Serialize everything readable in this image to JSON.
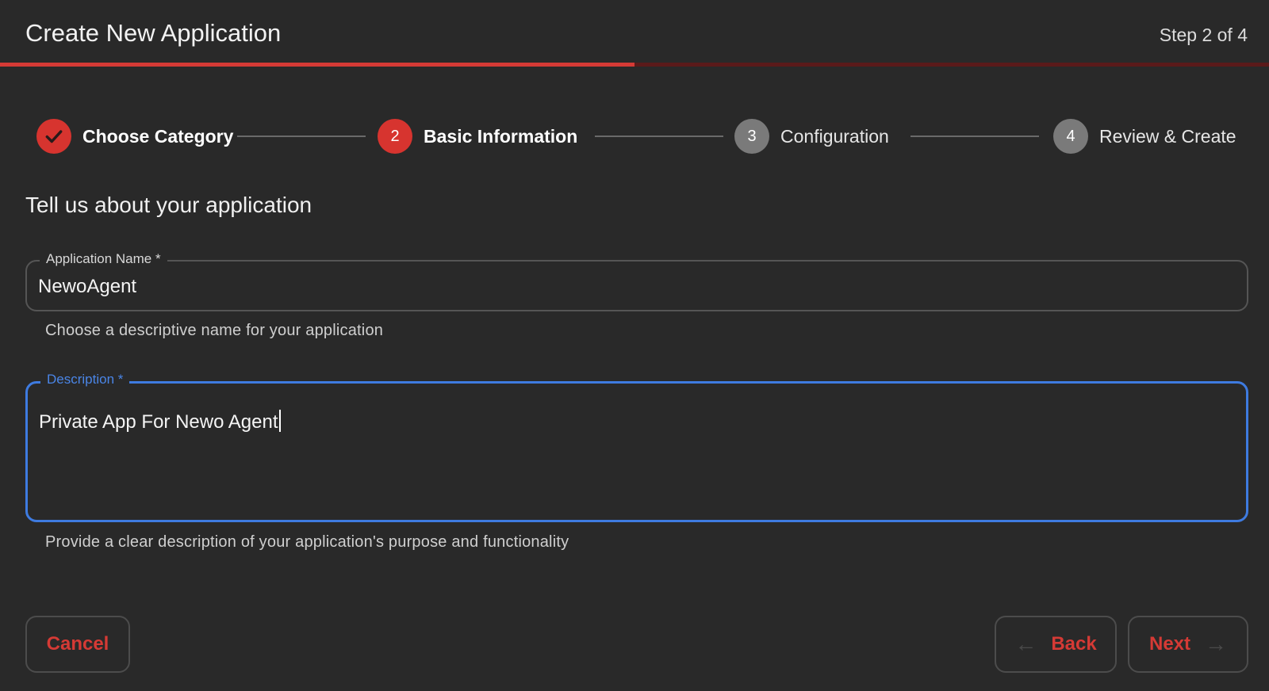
{
  "header": {
    "title": "Create New Application",
    "step_counter": "Step 2 of 4",
    "progress_fraction": 0.5
  },
  "stepper": {
    "steps": [
      {
        "label": "Choose Category",
        "number": "",
        "state": "completed",
        "icon": "check-icon"
      },
      {
        "label": "Basic Information",
        "number": "2",
        "state": "active"
      },
      {
        "label": "Configuration",
        "number": "3",
        "state": "pending"
      },
      {
        "label": "Review & Create",
        "number": "4",
        "state": "pending"
      }
    ]
  },
  "form": {
    "section_title": "Tell us about your application",
    "app_name": {
      "label": "Application Name *",
      "value": "NewoAgent",
      "helper": "Choose a descriptive name for your application"
    },
    "description": {
      "label": "Description *",
      "value": "Private App For Newo Agent",
      "helper": "Provide a clear description of your application's purpose and functionality",
      "focused": true
    }
  },
  "actions": {
    "cancel_label": "Cancel",
    "back_label": "Back",
    "next_label": "Next",
    "back_icon": "arrow-left-icon",
    "next_icon": "arrow-right-icon"
  },
  "colors": {
    "accent": "#d53a35",
    "focus": "#3e7be0",
    "background": "#292929",
    "pending_step": "#7a7a7a"
  }
}
